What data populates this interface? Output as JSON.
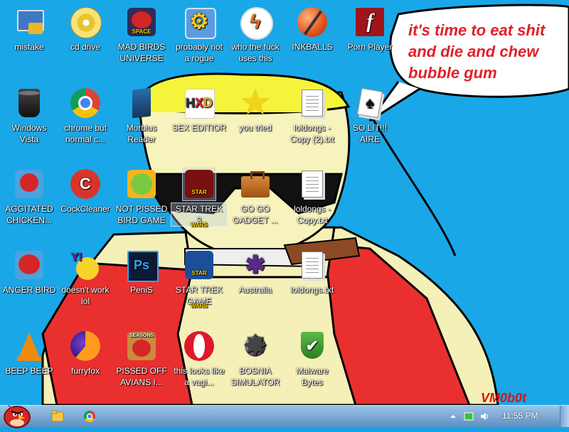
{
  "wallpaper": {
    "speech_text": "it's time to eat shit and die and chew bubble gum",
    "speech_lines": [
      "it's time to eat shit",
      "and die and chew",
      "bubble gum"
    ],
    "signature": "VM0b0t"
  },
  "icons": {
    "mistake": "mistake",
    "cd_drive": "cd drive",
    "mad_birds": "MAD BIRDS UNIVERSE",
    "rogue": "probably not a rogue",
    "who_uses": "who the fuck uses this",
    "inkballs": "INKBALLS",
    "porn_player": "Porn Player",
    "windows_vista": "Windows Vista",
    "chrome": "chrome but normal c...",
    "morbius": "Morbius Reader",
    "sex_editior": "SEX EDITIOR",
    "you_tried": "you tried",
    "loldongs_copy2": "loldongs - Copy (2).txt",
    "so_lit": "SO LIT!!! AIRE",
    "aggitated": "AGGITATED CHICKEN...",
    "cockcleaner": "CockCleaner",
    "not_pissed": "NOT PISSED BIRD GAME",
    "star_trek3": "STAR TREK 3",
    "go_gadget": "GO GO GADGET ...",
    "loldongs_copy": "loldongs - Copy.txt",
    "anger_bird": "ANGER BIRD",
    "doesnt_work": "doesn't work lol",
    "penis": "PeniS",
    "star_trek_game": "STAR TREK GAME",
    "australia": "Australia",
    "loldongs": "loldongs.txt",
    "beep_beep": "BEEP BEEP",
    "furryfox": "furryfox",
    "pissed_off": "PISSED OFF AVIANS I...",
    "vagina": "this looks like a vagi...",
    "bosnia": "BOSNIA SIMULATOR",
    "malware": "Malware Bytes"
  },
  "taskbar": {
    "clock": "11:55 PM"
  },
  "colors": {
    "desktop_bg": "#1aa7e8",
    "speech_text": "#e0202a",
    "taskbar": "#7ba8d8"
  }
}
